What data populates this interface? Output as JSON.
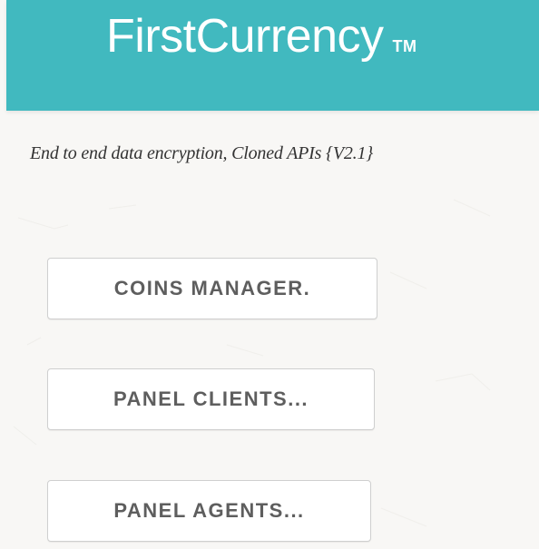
{
  "header": {
    "brand_name": "FirstCurrency",
    "trademark": "TM"
  },
  "tagline": "End to end data encryption, Cloned APIs {V2.1}",
  "buttons": [
    {
      "label": "COINS MANAGER."
    },
    {
      "label": "PANEL CLIENTS..."
    },
    {
      "label": "PANEL AGENTS..."
    }
  ],
  "colors": {
    "header_bg": "#41b9bf",
    "page_bg": "#f8f7f5",
    "button_text": "#5e5e5e",
    "button_border": "#cfcfcf"
  }
}
